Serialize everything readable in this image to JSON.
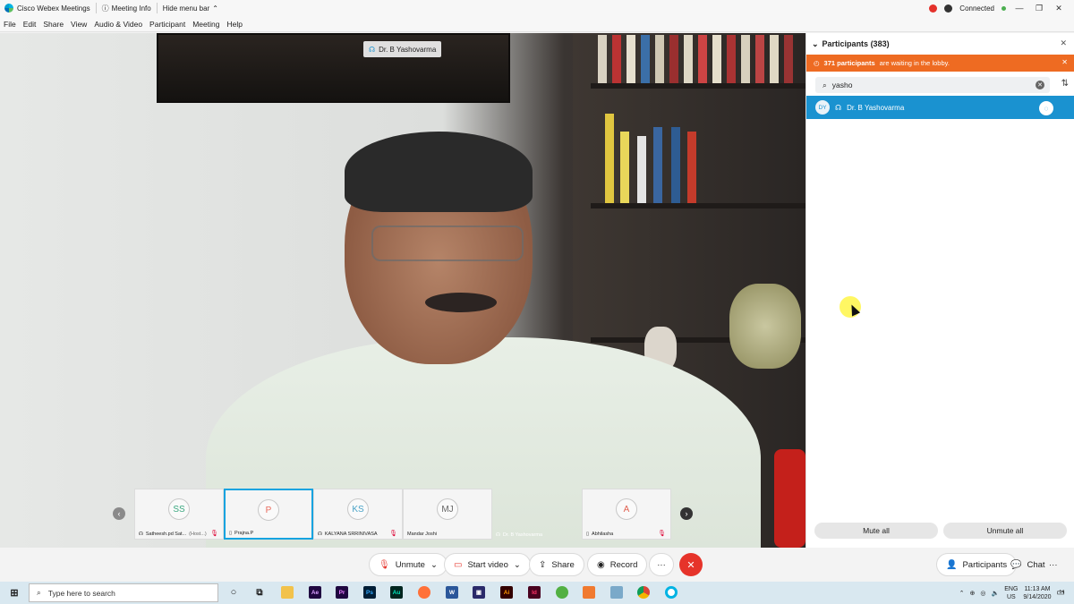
{
  "titlebar": {
    "app_name": "Cisco Webex Meetings",
    "meeting_info": "Meeting Info",
    "hide_menu": "Hide menu bar",
    "status": "Connected"
  },
  "menu": [
    "File",
    "Edit",
    "Share",
    "View",
    "Audio & Video",
    "Participant",
    "Meeting",
    "Help"
  ],
  "video": {
    "speaker_name": "Dr. B Yashovarma"
  },
  "thumbnails": [
    {
      "initials": "SS",
      "color": "#3aa77f",
      "name": "Satheesh.pd Sat...",
      "role": "(Host...)",
      "active": false
    },
    {
      "initials": "P",
      "color": "#e86a5c",
      "name": "Prajna.P",
      "role": "",
      "active": true
    },
    {
      "initials": "KS",
      "color": "#4aa3c7",
      "name": "KALYANA SRRINIVASA",
      "role": "",
      "active": false
    },
    {
      "initials": "MJ",
      "color": "#666666",
      "name": "Mandar Joshi",
      "role": "",
      "active": false
    },
    {
      "initials": "",
      "color": "#666666",
      "name": "Dr. B Yashovarma",
      "role": "",
      "active": false
    },
    {
      "initials": "A",
      "color": "#e06050",
      "name": "Abhilasha",
      "role": "",
      "active": false
    }
  ],
  "panel": {
    "title": "Participants (383)",
    "lobby_count": "371 participants",
    "lobby_text": "are waiting in the lobby.",
    "search_value": "yasho",
    "participant": {
      "initials": "DY",
      "name": "Dr. B Yashovarma"
    },
    "mute_all": "Mute all",
    "unmute_all": "Unmute all"
  },
  "controls": {
    "unmute": "Unmute",
    "start_video": "Start video",
    "share": "Share",
    "record": "Record",
    "more": "···",
    "participants": "Participants",
    "chat": "Chat"
  },
  "taskbar": {
    "search_placeholder": "Type here to search",
    "lang": "ENG",
    "region": "US",
    "time": "11:13 AM",
    "date": "9/14/2020",
    "notifications": "14"
  },
  "colors": {
    "accent": "#1a92d0",
    "lobby": "#ee6b22",
    "end_call": "#e6332a"
  }
}
